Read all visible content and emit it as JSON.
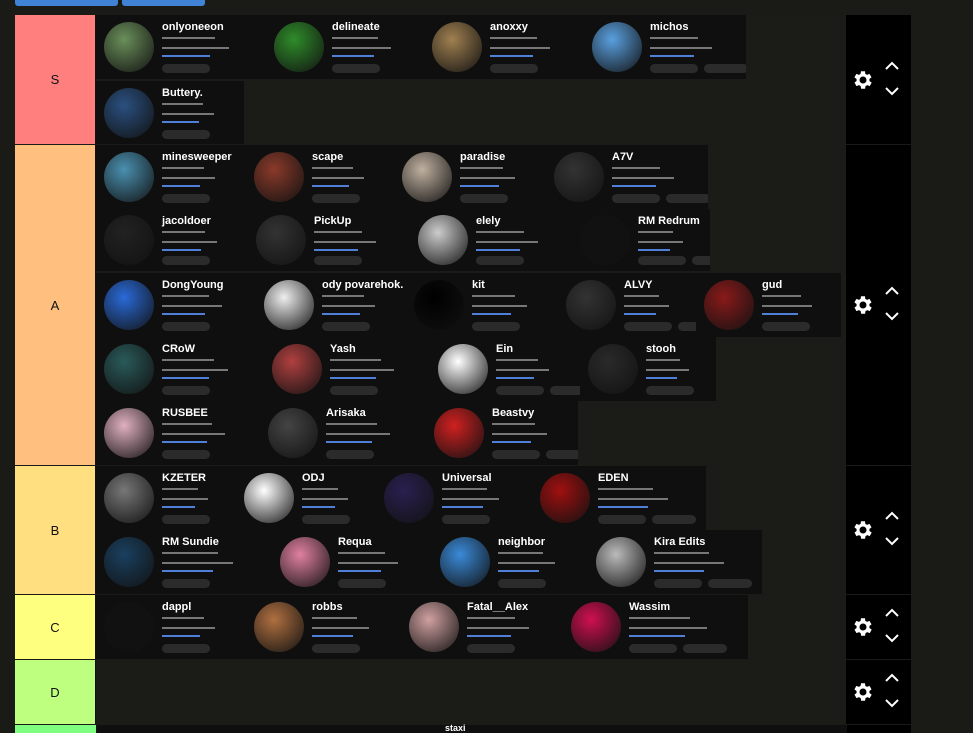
{
  "colors": {
    "S": "#ff7f7f",
    "A": "#ffbf7f",
    "B": "#ffdf7f",
    "C": "#ffff7f",
    "D": "#bfff7f",
    "E": "#7fff7f",
    "background": "#1a1a17",
    "controls": "#000000",
    "top_buttons": "#3f82d6"
  },
  "icons": {
    "settings": "gear-icon",
    "move_up": "chevron-up-icon",
    "move_down": "chevron-down-icon"
  },
  "tiers": [
    {
      "label": "S",
      "color": "#ff7f7f",
      "items": [
        "onlyoneeon",
        "delineate",
        "anoxxy",
        "michos",
        "Buttery."
      ]
    },
    {
      "label": "A",
      "color": "#ffbf7f",
      "items": [
        "minesweeper",
        "scape",
        "paradise",
        "A7V",
        "jacoldoer",
        "PickUp",
        "elely",
        "RM Redrum",
        "DongYoung",
        "ody povarehok.",
        "kit",
        "ALVY",
        "gud",
        "CRoW",
        "Yash",
        "Ein",
        "stooh",
        "RUSBEE",
        "Arisaka",
        "Beastvy"
      ]
    },
    {
      "label": "B",
      "color": "#ffdf7f",
      "items": [
        "KZETER",
        "ODJ",
        "Universal",
        "EDEN",
        "RM Sundie",
        "Requa",
        "neighbor",
        "Kira Edits"
      ]
    },
    {
      "label": "C",
      "color": "#ffff7f",
      "items": [
        "dappl",
        "robbs",
        "Fatal__Alex",
        "Wassim"
      ]
    },
    {
      "label": "D",
      "color": "#bfff7f",
      "items": []
    },
    {
      "label": "",
      "color": "#7fff7f",
      "items": [
        "staxi"
      ]
    }
  ]
}
